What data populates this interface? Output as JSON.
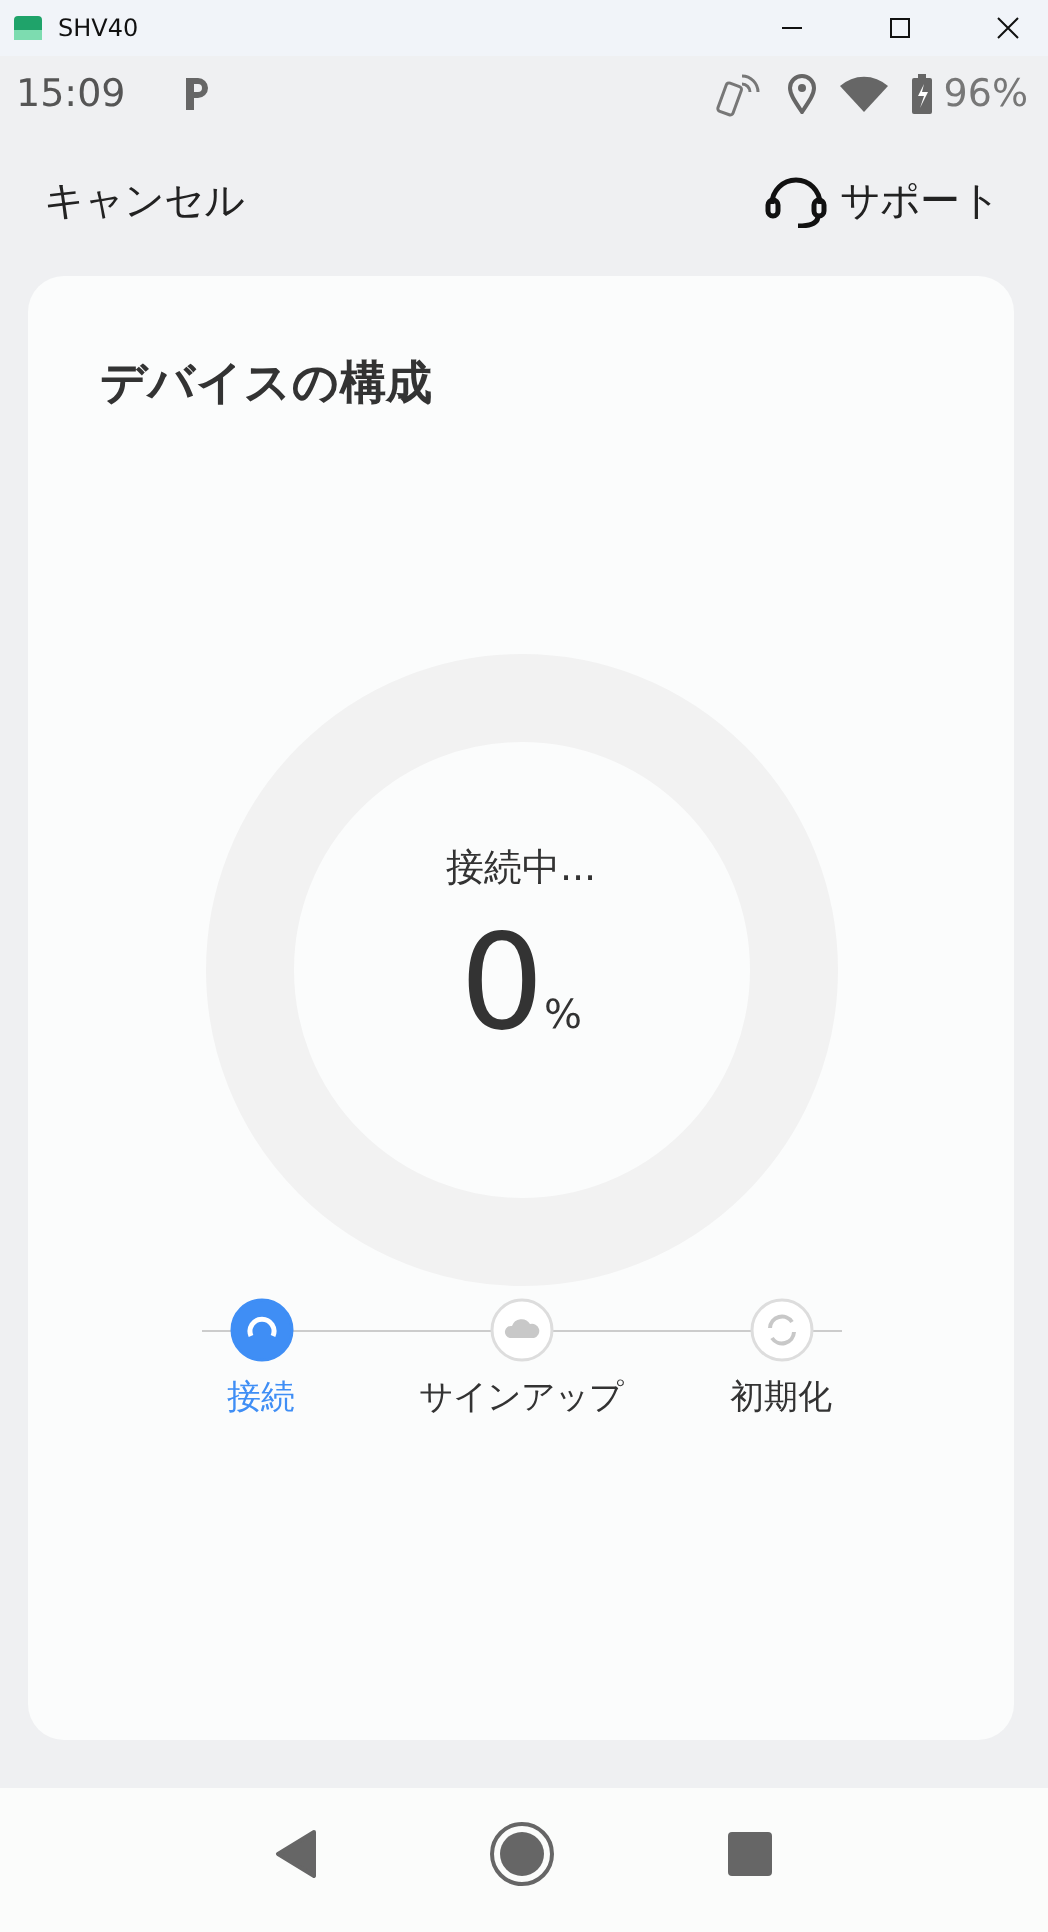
{
  "window": {
    "title": "SHV40"
  },
  "status_bar": {
    "time": "15:09",
    "battery": "96%"
  },
  "header": {
    "cancel": "キャンセル",
    "support": "サポート"
  },
  "card": {
    "title": "デバイスの構成",
    "progress": {
      "status": "接続中...",
      "value": "0",
      "unit": "%"
    },
    "steps": [
      {
        "kind": "connect",
        "label": "接続",
        "selected": true
      },
      {
        "kind": "cloud",
        "label": "サインアップ",
        "selected": false
      },
      {
        "kind": "refresh",
        "label": "初期化",
        "selected": false
      }
    ]
  }
}
